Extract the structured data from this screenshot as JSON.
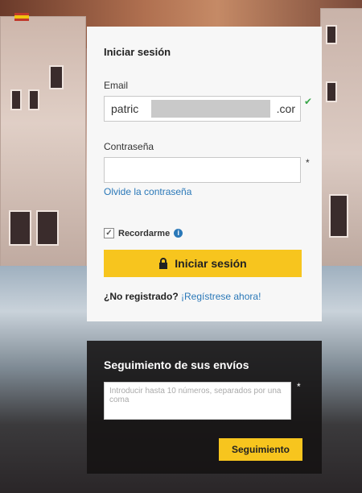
{
  "login": {
    "title": "Iniciar sesión",
    "email_label": "Email",
    "email_value_start": "patric",
    "email_value_end": ".cor",
    "password_label": "Contraseña",
    "required_mark": "*",
    "forgot_password": "Olvide la contraseña",
    "remember_me": "Recordarme",
    "remember_checked": true,
    "submit_label": "Iniciar sesión",
    "not_registered": "¿No registrado?",
    "register_link": "¡Regístrese ahora!"
  },
  "tracking": {
    "title": "Seguimiento de sus envíos",
    "placeholder": "Introducir hasta 10 números, separados por una coma",
    "required_mark": "*",
    "button_label": "Seguimiento"
  },
  "colors": {
    "accent": "#f7c51e",
    "link": "#2a78b8",
    "valid": "#3aa64a"
  }
}
